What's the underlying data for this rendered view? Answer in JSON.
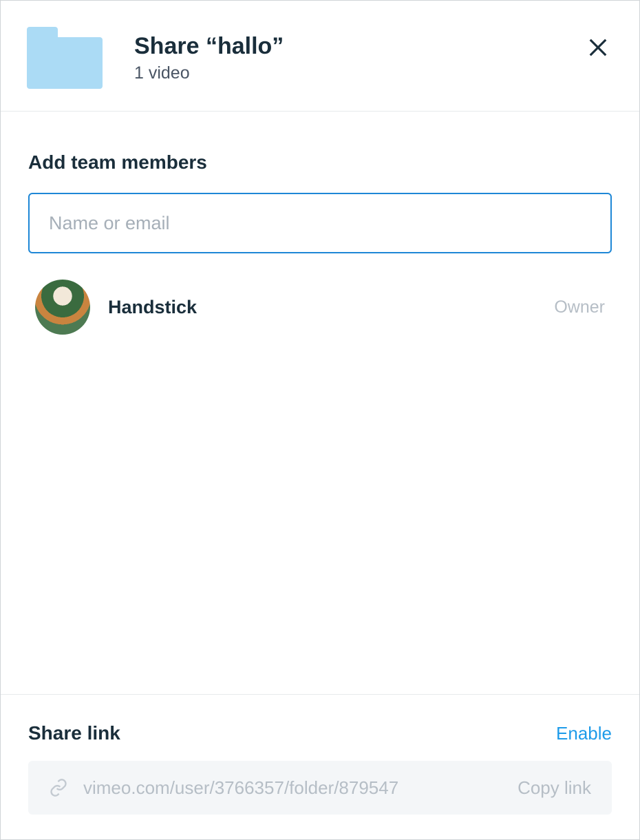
{
  "header": {
    "title": "Share “hallo”",
    "subtitle": "1 video"
  },
  "addMembers": {
    "heading": "Add team members",
    "placeholder": "Name or email"
  },
  "members": [
    {
      "name": "Handstick",
      "role": "Owner"
    }
  ],
  "shareLink": {
    "heading": "Share link",
    "toggleLabel": "Enable",
    "url": "vimeo.com/user/3766357/folder/879547",
    "copyLabel": "Copy link"
  }
}
